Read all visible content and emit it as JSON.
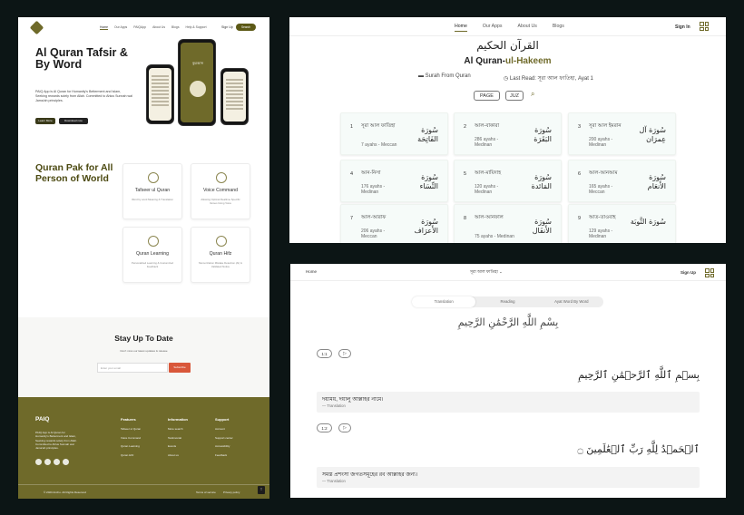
{
  "landing": {
    "nav": [
      "Home",
      "Our Apps",
      "PAIQApp",
      "About Us",
      "Blogs",
      "Help & Support"
    ],
    "signin": "Sign Up",
    "start": "Search",
    "hero_title": "Al Quran Tafsir & By Word",
    "hero_desc": "PAIQ App is Al Quran for Humanity's Betterment and Islam, Seeking rewards solely from Allah. Committed to Ahlus Sunnah wal Jama'ah principles.",
    "btn_learn": "Learn More",
    "btn_download": "Download now",
    "phone_title": "কুরআন",
    "section_title": "Quran Pak for All Person of World",
    "features": [
      {
        "title": "Tafseer ul Quran",
        "desc": "Word by word Meaning & Translation"
      },
      {
        "title": "Voice Command",
        "desc": "Allowing Optimal Realtime Specific Verses Using Voice"
      },
      {
        "title": "Quran Learning",
        "desc": "Personalized Learning & Customized Feedback"
      },
      {
        "title": "Quran Hifz",
        "desc": "Memorization Mistake Detection (AI) & Validated Notice"
      }
    ],
    "subscribe": {
      "title": "Stay Up To Date",
      "desc": "Don't miss our latest updates & release",
      "placeholder": "Enter your email",
      "button": "Subscribe"
    },
    "footer": {
      "brand": "PAIQ",
      "desc": "PAIQ App is Al Quran for Humanity's Betterment and Islam, Seeking rewards solely from Allah. Committed to Ahlus Sunnah wal Jama'ah principles.",
      "cols": [
        {
          "head": "Features",
          "items": [
            "Tafseer ul Quran",
            "Voice Command",
            "Quran Learning",
            "Quran Hifz"
          ]
        },
        {
          "head": "Information",
          "items": [
            "More search",
            "Testimonial",
            "Events",
            "About us"
          ]
        },
        {
          "head": "Support",
          "items": [
            "Account",
            "Support center",
            "Accessibility",
            "Feedback"
          ]
        }
      ],
      "copy": "© 2023 Ancho. All Rights Reserved",
      "terms": "Terms of service",
      "privacy": "Privacy policy",
      "up": "↑"
    }
  },
  "surah_list": {
    "nav": [
      "Home",
      "Our Apps",
      "About Us",
      "Blogs"
    ],
    "signin": "Sign In",
    "arabic_title": "القرآن الحكيم",
    "title_a": "Al Quran-",
    "title_b": "ul-Hakeem",
    "meta1": "Surah From Quran",
    "meta2": "Last Read: সূরা আল ফাতিহা, Ayat 1",
    "page_btn": "PAGE",
    "juz_btn": "JUZ",
    "surahs": [
      {
        "n": "1",
        "name": "সূরা আল ফাতিহা",
        "ayahs": "7 ayahs - Meccan",
        "ar": "سُورَة الفَاتِحَة"
      },
      {
        "n": "2",
        "name": "আল-বাকারা",
        "ayahs": "286 ayahs - Medinan",
        "ar": "سُورَة البَقَرَة"
      },
      {
        "n": "3",
        "name": "সূরা আল ইমরান",
        "ayahs": "200 ayahs - Medinan",
        "ar": "سُورَة آل عِمرَان"
      },
      {
        "n": "4",
        "name": "আন-নিসা",
        "ayahs": "176 ayahs - Medinan",
        "ar": "سُورَة النِّسَاء"
      },
      {
        "n": "5",
        "name": "আল-মায়িদাহ",
        "ayahs": "120 ayahs - Medinan",
        "ar": "سُورَة المَائدة"
      },
      {
        "n": "6",
        "name": "আল-আনআম",
        "ayahs": "165 ayahs - Meccan",
        "ar": "سُورَة الأَنعَام"
      },
      {
        "n": "7",
        "name": "আল-আরাফ",
        "ayahs": "206 ayahs - Meccan",
        "ar": "سُورَة الأَعرَاف"
      },
      {
        "n": "8",
        "name": "আল-আনফাল",
        "ayahs": "75 ayahs - Medinan",
        "ar": "سُورَة الأَنفَال"
      },
      {
        "n": "9",
        "name": "আত-তাওবাহ",
        "ayahs": "129 ayahs - Medinan",
        "ar": "سُورَة التَّوبَة"
      }
    ]
  },
  "reader": {
    "home": "Home",
    "surah_select": "সূরা আল ফাতিহা ⌄",
    "signin": "Sign Up",
    "tabs": [
      "Translation",
      "Reading",
      "Ayat Word By Word"
    ],
    "bismillah": "بِسْمِ اللَّهِ الرَّحْمَٰنِ الرَّحِيمِ",
    "verses": [
      {
        "num": "1:1",
        "arabic": "بِسۡمِ ٱللَّهِ ٱلرَّحۡمَٰنِ ٱلرَّحِيمِ",
        "trans": "দয়াময়, দয়ালু আল্লাহর নামে।",
        "label": "— Translation"
      },
      {
        "num": "1:2",
        "arabic": "ٱلۡحَمۡدُ لِلَّهِ رَبِّ ٱلۡعَٰلَمِينَ ۝",
        "trans": "সমস্ত প্রশংসা জগতসমূহের রব আল্লাহর জন্য।",
        "label": "— Translation"
      }
    ],
    "play": "▷"
  },
  "colors": {
    "accent": "#6f6a2a",
    "subscribe": "#d9573a",
    "background": "#0c1515"
  }
}
